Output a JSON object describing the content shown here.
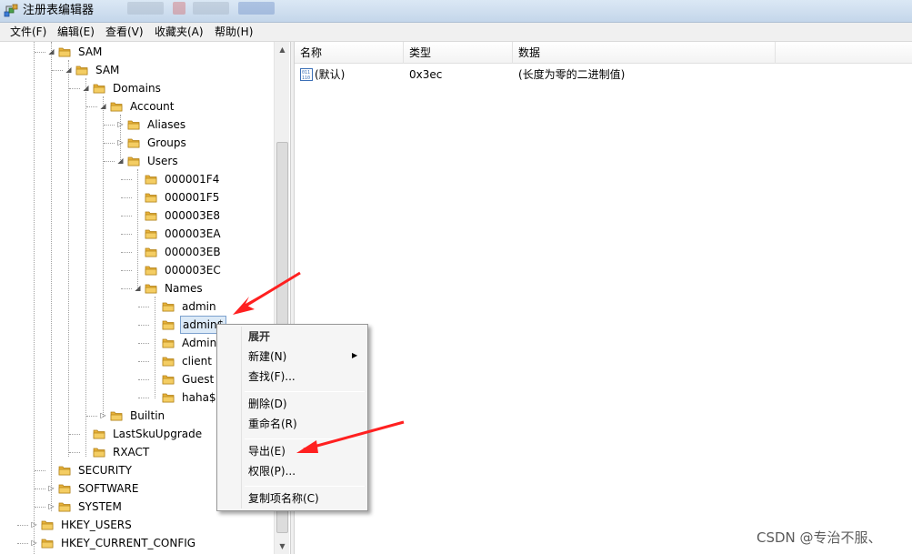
{
  "window": {
    "title": "注册表编辑器"
  },
  "menu": [
    "文件(F)",
    "编辑(E)",
    "查看(V)",
    "收藏夹(A)",
    "帮助(H)"
  ],
  "tree": [
    {
      "label": "SAM",
      "level": 0,
      "toggle": "expanded"
    },
    {
      "label": "SAM",
      "level": 1,
      "toggle": "expanded"
    },
    {
      "label": "Domains",
      "level": 2,
      "toggle": "expanded"
    },
    {
      "label": "Account",
      "level": 3,
      "toggle": "expanded"
    },
    {
      "label": "Aliases",
      "level": 4,
      "toggle": "collapsed"
    },
    {
      "label": "Groups",
      "level": 4,
      "toggle": "collapsed"
    },
    {
      "label": "Users",
      "level": 4,
      "toggle": "expanded"
    },
    {
      "label": "000001F4",
      "level": 5,
      "toggle": "none"
    },
    {
      "label": "000001F5",
      "level": 5,
      "toggle": "none"
    },
    {
      "label": "000003E8",
      "level": 5,
      "toggle": "none"
    },
    {
      "label": "000003EA",
      "level": 5,
      "toggle": "none"
    },
    {
      "label": "000003EB",
      "level": 5,
      "toggle": "none"
    },
    {
      "label": "000003EC",
      "level": 5,
      "toggle": "none"
    },
    {
      "label": "Names",
      "level": 5,
      "toggle": "expanded"
    },
    {
      "label": "admin",
      "level": 6,
      "toggle": "none"
    },
    {
      "label": "admin$",
      "level": 6,
      "toggle": "none",
      "selected": true
    },
    {
      "label": "Admin",
      "level": 6,
      "toggle": "none"
    },
    {
      "label": "client",
      "level": 6,
      "toggle": "none"
    },
    {
      "label": "Guest",
      "level": 6,
      "toggle": "none"
    },
    {
      "label": "haha$",
      "level": 6,
      "toggle": "none"
    },
    {
      "label": "Builtin",
      "level": 3,
      "toggle": "collapsed"
    },
    {
      "label": "LastSkuUpgrade",
      "level": 2,
      "toggle": "none"
    },
    {
      "label": "RXACT",
      "level": 2,
      "toggle": "none"
    },
    {
      "label": "SECURITY",
      "level": 0,
      "toggle": "none"
    },
    {
      "label": "SOFTWARE",
      "level": 0,
      "toggle": "collapsed"
    },
    {
      "label": "SYSTEM",
      "level": 0,
      "toggle": "collapsed"
    },
    {
      "label": "HKEY_USERS",
      "level": -1,
      "toggle": "collapsed"
    },
    {
      "label": "HKEY_CURRENT_CONFIG",
      "level": -1,
      "toggle": "collapsed"
    }
  ],
  "list": {
    "headers": [
      "名称",
      "类型",
      "数据"
    ],
    "rows": [
      {
        "name": "(默认)",
        "type": "0x3ec",
        "data": "(长度为零的二进制值)"
      }
    ]
  },
  "context_menu": {
    "expand": "展开",
    "new": "新建(N)",
    "find": "查找(F)...",
    "delete": "删除(D)",
    "rename": "重命名(R)",
    "export": "导出(E)",
    "permissions": "权限(P)...",
    "copy_key_name": "复制项名称(C)"
  },
  "watermark": "CSDN @专治不服、",
  "colors": {
    "annotation_arrow": "#ff2020",
    "folder": "#e8b23a"
  }
}
